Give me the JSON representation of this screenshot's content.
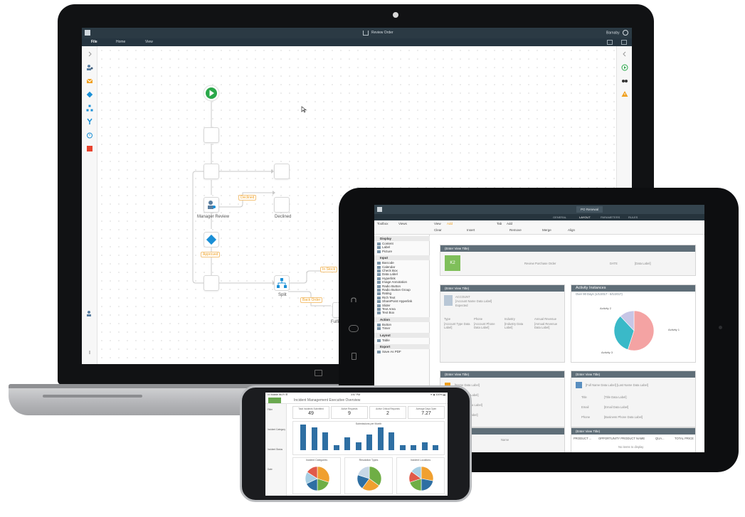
{
  "laptop": {
    "app_title": "Review Order",
    "user": "Barnaby",
    "menu": [
      "File",
      "Home",
      "View"
    ],
    "workflow": {
      "labels": {
        "manager_review": "Manager Review",
        "declined": "Declined",
        "split": "Split",
        "fulfill": "Fulfi"
      },
      "tags": {
        "declined": "Declined",
        "approved": "Approved",
        "in_stock": "In Stock",
        "back_order": "Back Order"
      }
    }
  },
  "tablet": {
    "doc_tab": "PO Renewal",
    "tabs": [
      "GENERAL",
      "LAYOUT",
      "PARAMETERS",
      "RULES"
    ],
    "toolbar": {
      "toolbox": "Toolbox",
      "views": "Views",
      "view": "View",
      "add": "Add",
      "tab": "Tab",
      "add2": "Add",
      "clear": "Clear",
      "insert": "Insert",
      "remove": "Remove",
      "merge": "Merge",
      "align": "Align"
    },
    "sidebar": [
      {
        "head": "Display",
        "items": [
          "Content",
          "Label",
          "Picture"
        ]
      },
      {
        "head": "Input",
        "items": [
          "Barcode",
          "Calendar",
          "Check Box",
          "Data Label",
          "Hyperlink",
          "Image Annotation",
          "Radio Button",
          "Radio Button Group",
          "Rating",
          "Rich Text",
          "SharePoint Hyperlink",
          "Slider",
          "Text Area",
          "Text Box"
        ]
      },
      {
        "head": "Action",
        "items": [
          "Button",
          "Timer"
        ]
      },
      {
        "head": "Layout",
        "items": [
          "Table"
        ]
      },
      {
        "head": "Export",
        "items": [
          "Save As PDF"
        ]
      }
    ],
    "panels": {
      "title_placeholder": "(Enter View Title)",
      "logo_text": "K2",
      "review_po": "Review Purchase Order",
      "date_label": "DATE",
      "data_label": "[Data Label]",
      "account": "ACCOUNT",
      "account_name": "[Account Name Data Label]",
      "expected": "Expected",
      "cols": [
        "Type",
        "Phone",
        "Industry",
        "Annual Revenue"
      ],
      "vals": [
        "[Account Type Data Label]",
        "[Account Phone Data Label]",
        "[Industry Data Label]",
        "[Annual Revenue Data Label]"
      ],
      "activity_title": "Activity Instances",
      "activity_sub": "Over 90 Days (1/1/2017 - 8/1/2017)",
      "pie_labels": [
        "Activity 2",
        "Activity 1",
        "Activity 3"
      ],
      "contact_rows": [
        "[Name Data Label]",
        "[Page Data Label]",
        "[Account Data Label]",
        "[User Data Label]"
      ],
      "info_name": "[Full Name Data Label] [Last Name Data Label]",
      "info_fields": [
        [
          "Title",
          "[Title Data Label]"
        ],
        [
          "Email",
          "[Email Data Label]"
        ],
        [
          "Phone",
          "[Business Phone Data Label]"
        ]
      ],
      "grid_cols": [
        "PRODUCT ...",
        "OPPORTUNITY PRODUCT NAME",
        "QUA...",
        "TOTAL PRICE"
      ],
      "no_items": "No items to display",
      "name_col": "Name"
    }
  },
  "phone": {
    "status_left": "••• Mobile Wi-Fi ☰",
    "status_time": "3:57 PM",
    "status_right": "✈ ◉ 100% ▬",
    "title": "Incident Management Executive Overview",
    "kpis": [
      {
        "label": "Total Incidents Submitted",
        "value": "49"
      },
      {
        "label": "Active Requests",
        "value": "9"
      },
      {
        "label": "Active Critical Requests",
        "value": "2"
      },
      {
        "label": "Average Days Open",
        "value": "7.27"
      }
    ],
    "sidebar": [
      "Filter",
      "Incident Category",
      "Incident Status",
      "Date"
    ],
    "bar_chart": {
      "title": "Submissions per Month"
    },
    "pie_titles": [
      "Incident Categories",
      "Resolution Types",
      "Incident Locations"
    ]
  },
  "colors": {
    "start_green": "#2aa84a",
    "gateway_blue": "#1a8fd6",
    "accent_orange": "#f0a020",
    "stop_red": "#e8432e",
    "panel_header": "#5f6e78",
    "bar_blue": "#2e6fa3"
  },
  "chart_data": [
    {
      "type": "pie",
      "title": "Activity Instances",
      "categories": [
        "Activity 1",
        "Activity 2",
        "Activity 3"
      ],
      "values": [
        55,
        33,
        12
      ],
      "colors": [
        "#f4a3a3",
        "#3ab9c8",
        "#c7c6e6"
      ]
    },
    {
      "type": "bar",
      "title": "Submissions per Month",
      "categories": [
        "1",
        "2",
        "3",
        "4",
        "5",
        "6",
        "7",
        "8",
        "9",
        "10",
        "11",
        "12",
        "13"
      ],
      "values": [
        10,
        9,
        7,
        2,
        5,
        3,
        6,
        9,
        7,
        2,
        2,
        3,
        2
      ],
      "ylim": [
        0,
        10
      ]
    },
    {
      "type": "pie",
      "title": "Incident Categories",
      "values": [
        30,
        20,
        18,
        16,
        16
      ],
      "colors": [
        "#f0a030",
        "#6fae45",
        "#2e6fa3",
        "#a6cee3",
        "#e05a4a"
      ]
    },
    {
      "type": "pie",
      "title": "Resolution Types",
      "values": [
        35,
        25,
        20,
        20
      ],
      "colors": [
        "#6fae45",
        "#f0a030",
        "#2e6fa3",
        "#c7d7e6"
      ]
    },
    {
      "type": "pie",
      "title": "Incident Locations",
      "values": [
        28,
        22,
        20,
        15,
        15
      ],
      "colors": [
        "#f0a030",
        "#2e6fa3",
        "#6fae45",
        "#e05a4a",
        "#a6cee3"
      ]
    }
  ]
}
